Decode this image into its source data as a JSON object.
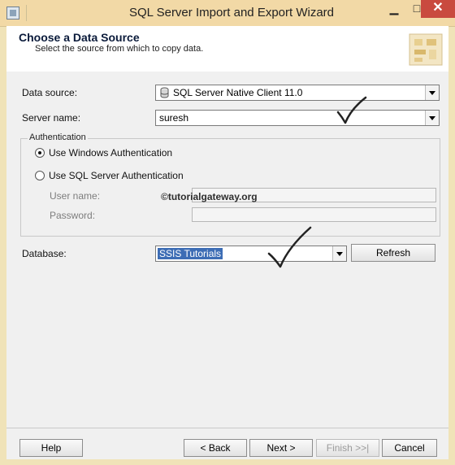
{
  "window": {
    "title": "SQL Server Import and Export Wizard",
    "minimize_glyph": "▁",
    "maximize_glyph": "□",
    "close_glyph": "✕"
  },
  "header": {
    "title": "Choose a Data Source",
    "subtitle": "Select the source from which to copy data."
  },
  "form": {
    "data_source_label": "Data source:",
    "data_source_value": "SQL Server Native Client 11.0",
    "data_source_icon": "database-icon",
    "server_name_label": "Server name:",
    "server_name_value": "suresh",
    "authentication": {
      "legend": "Authentication",
      "windows_auth_label": "Use Windows Authentication",
      "windows_auth_checked": true,
      "sql_auth_label": "Use SQL Server Authentication",
      "sql_auth_checked": false,
      "user_name_label": "User name:",
      "user_name_value": "",
      "password_label": "Password:",
      "password_value": ""
    },
    "watermark": "©tutorialgateway.org",
    "database_label": "Database:",
    "database_value": "SSIS Tutorials",
    "refresh_label": "Refresh"
  },
  "footer": {
    "help_label": "Help",
    "back_label": "< Back",
    "next_label": "Next >",
    "finish_label": "Finish >>|",
    "cancel_label": "Cancel"
  },
  "colors": {
    "title_bar": "#f2d9a6",
    "close_button": "#c94a3f",
    "selection": "#3d6db5",
    "annotation_ink": "#222222"
  }
}
